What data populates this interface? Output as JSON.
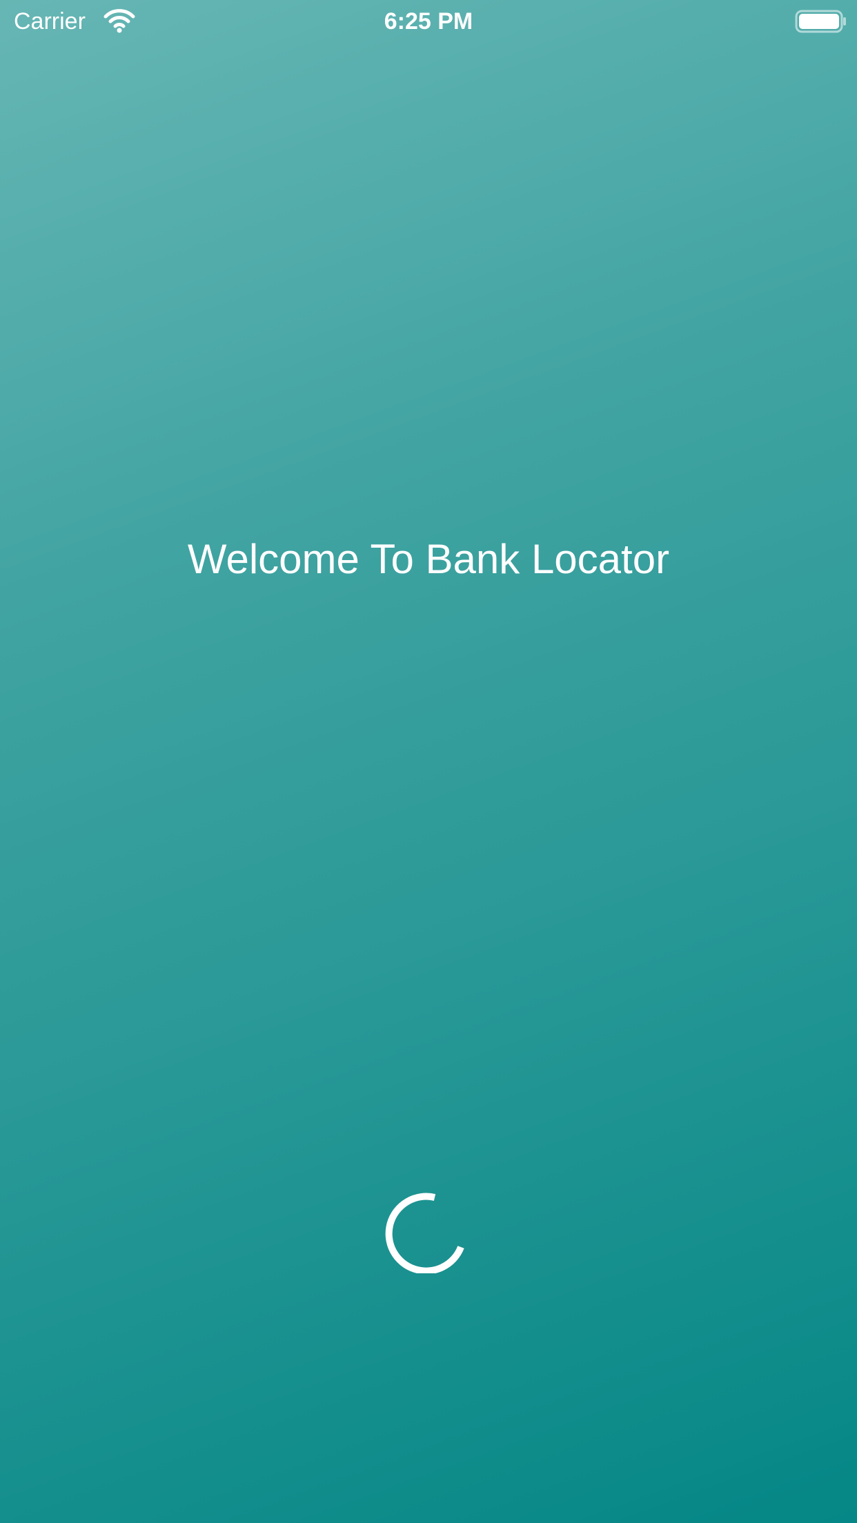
{
  "status_bar": {
    "carrier": "Carrier",
    "time": "6:25 PM",
    "wifi_icon": "wifi-icon",
    "battery_icon": "battery-icon"
  },
  "main": {
    "title": "Welcome To Bank Locator",
    "loading_icon": "loading-spinner-icon"
  },
  "colors": {
    "gradient_start": "#66b6b4",
    "gradient_end": "#048786",
    "text": "#ffffff"
  }
}
